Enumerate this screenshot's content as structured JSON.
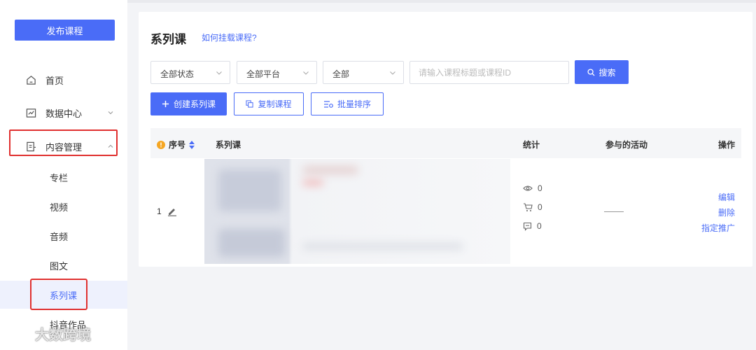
{
  "sidebar": {
    "publish_button": "发布课程",
    "items": [
      {
        "label": "首页",
        "icon": "home-icon"
      },
      {
        "label": "数据中心",
        "icon": "chart-icon"
      },
      {
        "label": "内容管理",
        "icon": "document-icon"
      }
    ],
    "subitems": [
      "专栏",
      "视频",
      "音频",
      "图文",
      "系列课",
      "抖音作品"
    ],
    "active_subitem": "系列课"
  },
  "header": {
    "title": "系列课",
    "help_link": "如何挂载课程?"
  },
  "filters": {
    "status": "全部状态",
    "platform": "全部平台",
    "type": "全部",
    "search_placeholder": "请输入课程标题或课程ID",
    "search_button": "搜索"
  },
  "actions": {
    "create": "创建系列课",
    "copy": "复制课程",
    "sort": "批量排序"
  },
  "table": {
    "columns": {
      "index": "序号",
      "course": "系列课",
      "stats": "统计",
      "activity": "参与的活动",
      "ops": "操作"
    },
    "rows": [
      {
        "index": "1",
        "views": "0",
        "cart": "0",
        "comments": "0",
        "ops": [
          "编辑",
          "删除",
          "指定推广"
        ]
      }
    ]
  },
  "watermark": "大数跨境",
  "colors": {
    "accent": "#4a6cf7",
    "highlight": "#e0302f",
    "warning": "#f5a623"
  }
}
